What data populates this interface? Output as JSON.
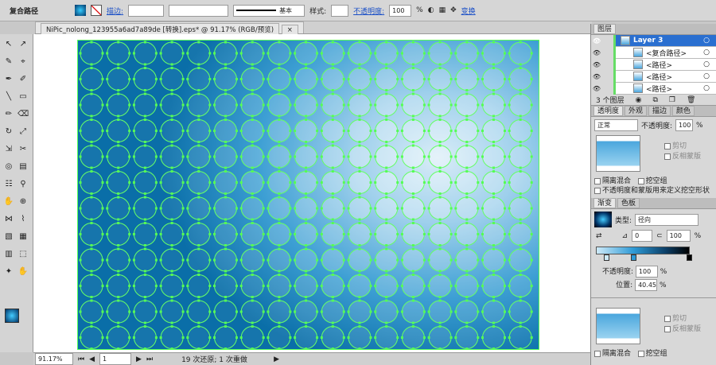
{
  "control_bar": {
    "selection_label": "复合路径",
    "stroke_label": "描边:",
    "stroke_style": "基本",
    "style_label": "样式:",
    "opacity_label": "不透明度:",
    "opacity_value": "100",
    "percent": "%",
    "transform_label": "变换"
  },
  "document_tab": {
    "title": "NiPic_nolong_123955a6ad7a89de  [转换].eps* @ 91.17% (RGB/预览)",
    "close": "×"
  },
  "status": {
    "zoom": "91.17%",
    "page": "1",
    "history": "19 次还原; 1 次重做"
  },
  "layers_panel": {
    "title": "图层",
    "layers": [
      {
        "name": "Layer 3"
      },
      {
        "name": "<复合路径>"
      },
      {
        "name": "<路径>"
      },
      {
        "name": "<路径>"
      },
      {
        "name": "<路径>"
      }
    ],
    "count": "3 个图层"
  },
  "transparency_panel": {
    "tabs": [
      "透明度",
      "外观",
      "描边",
      "颜色"
    ],
    "blend_mode": "正常",
    "opacity_label": "不透明度:",
    "opacity_value": "100",
    "percent": "%",
    "clip": "剪切",
    "invert_mask": "反相蒙版",
    "isolate_blend": "隔离混合",
    "knockout_group": "挖空组",
    "opacity_mask_knockout": "不透明度和蒙版用来定义挖空形状"
  },
  "gradient_panel": {
    "tabs": [
      "渐变",
      "色板"
    ],
    "type_label": "类型:",
    "type_value": "径向",
    "angle": "0",
    "aspect": "100",
    "percent": "%",
    "opacity_label": "不透明度:",
    "opacity_value": "100",
    "location_label": "位置:",
    "location_value": "40.45"
  },
  "second_panel": {
    "clip": "剪切",
    "invert_mask": "反相蒙版",
    "isolate_blend": "隔离混合",
    "knockout_group": "挖空组"
  }
}
